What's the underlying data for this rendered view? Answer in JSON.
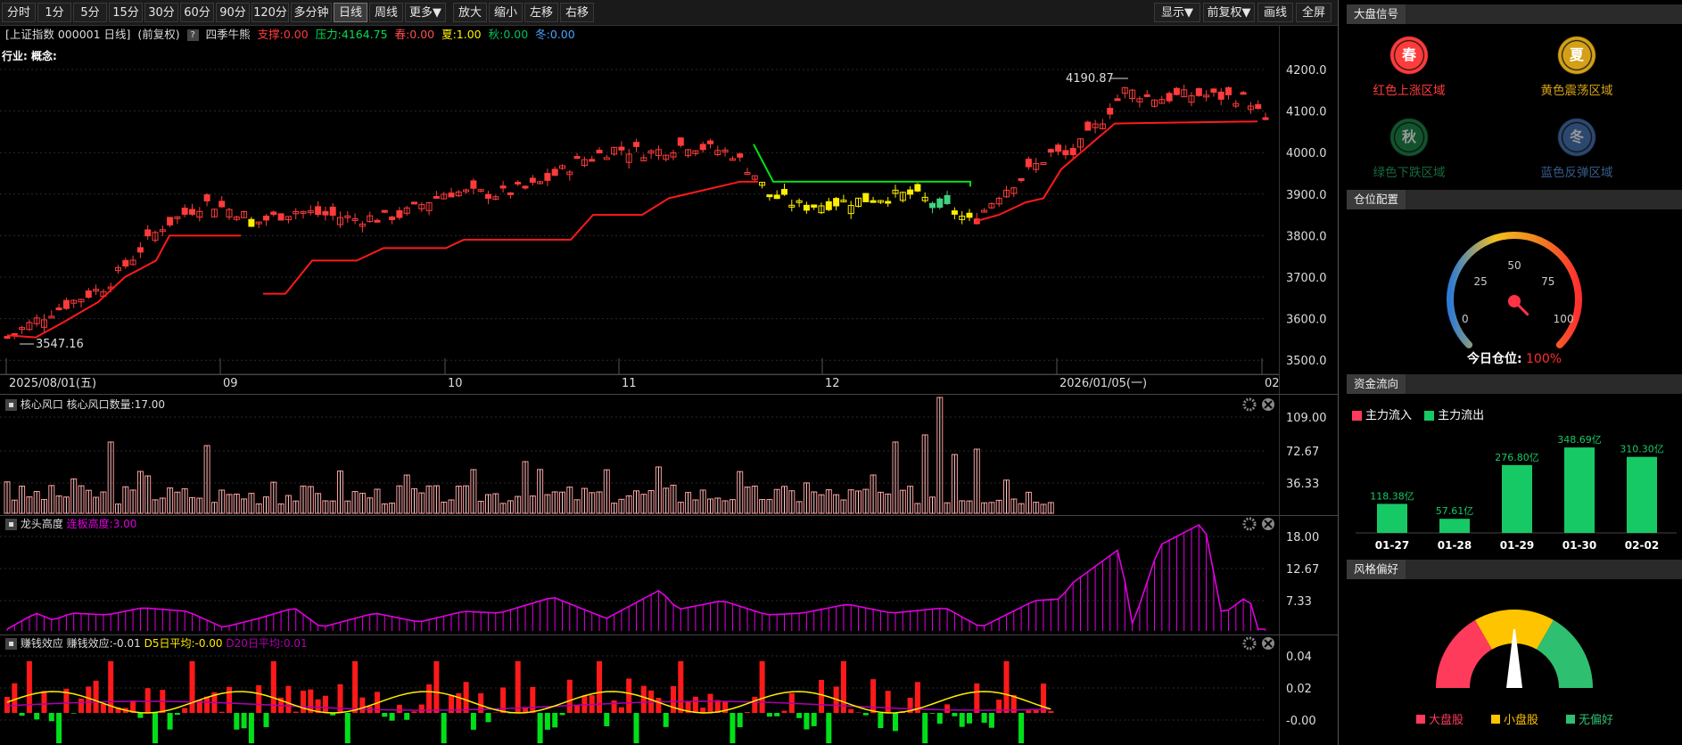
{
  "toolbar": {
    "left": [
      {
        "label": "分时",
        "active": false
      },
      {
        "label": "1分",
        "active": false
      },
      {
        "label": "5分",
        "active": false
      },
      {
        "label": "15分",
        "active": false
      },
      {
        "label": "30分",
        "active": false
      },
      {
        "label": "60分",
        "active": false
      },
      {
        "label": "90分",
        "active": false
      },
      {
        "label": "120分",
        "active": false
      },
      {
        "label": "多分钟",
        "active": false
      },
      {
        "label": "日线",
        "active": true
      },
      {
        "label": "周线",
        "active": false
      },
      {
        "label": "更多▼",
        "active": false
      },
      {
        "label": "放大",
        "active": false
      },
      {
        "label": "缩小",
        "active": false
      },
      {
        "label": "左移",
        "active": false
      },
      {
        "label": "右移",
        "active": false
      }
    ],
    "right": [
      {
        "label": "显示▼"
      },
      {
        "label": "前复权▼"
      },
      {
        "label": "画线"
      },
      {
        "label": "全屏"
      }
    ]
  },
  "info": {
    "index": "[上证指数 000001 日线]",
    "adjust": "(前复权)",
    "q": "?",
    "indicator": "四季牛熊",
    "support": "支撑:0.00",
    "pressure": "压力:4164.75",
    "spring": "春:0.00",
    "summer": "夏:1.00",
    "autumn": "秋:0.00",
    "winter": "冬:0.00",
    "industry": "行业: 概念:"
  },
  "main_chart": {
    "y_ticks": [
      "4200.0",
      "4100.0",
      "4000.0",
      "3900.0",
      "3800.0",
      "3700.0",
      "3600.0",
      "3500.0"
    ],
    "high_label": "4190.87",
    "low_label": "3547.16",
    "x_labels": [
      "2025/08/01(五)",
      "09",
      "10",
      "11",
      "12",
      "2026/01/05(一)",
      "02"
    ]
  },
  "panel1": {
    "name": "核心风口",
    "value_text": "核心风口数量:17.00",
    "y_ticks": [
      "109.00",
      "72.67",
      "36.33"
    ]
  },
  "panel2": {
    "name": "龙头高度",
    "value_text": "连板高度:3.00",
    "y_ticks": [
      "18.00",
      "12.67",
      "7.33"
    ]
  },
  "panel3": {
    "name": "赚钱效应",
    "value_text": "赚钱效应:-0.01",
    "d5": "D5日平均:-0.00",
    "d20": "D20日平均:0.01",
    "y_ticks": [
      "0.04",
      "0.02",
      "-0.00"
    ]
  },
  "signal": {
    "title": "大盘信号",
    "items": [
      {
        "glyph": "春",
        "label": "红色上涨区域",
        "color": "#ff3b3b"
      },
      {
        "glyph": "夏",
        "label": "黄色震荡区域",
        "color": "#d4a017"
      },
      {
        "glyph": "秋",
        "label": "绿色下跌区域",
        "color": "#1f8a4c"
      },
      {
        "glyph": "冬",
        "label": "蓝色反弹区域",
        "color": "#4a78b8"
      }
    ]
  },
  "position": {
    "title": "仓位配置",
    "ticks": [
      "0",
      "25",
      "50",
      "75",
      "100"
    ],
    "label": "今日仓位:",
    "value": "100%",
    "level": 1.0
  },
  "fundflow": {
    "title": "资金流向",
    "legend_in": "主力流入",
    "legend_out": "主力流出",
    "bars": [
      {
        "date": "01-27",
        "value": 118.38,
        "label": "118.38亿"
      },
      {
        "date": "01-28",
        "value": 57.61,
        "label": "57.61亿"
      },
      {
        "date": "01-29",
        "value": 276.8,
        "label": "276.80亿"
      },
      {
        "date": "01-30",
        "value": 348.69,
        "label": "348.69亿"
      },
      {
        "date": "02-02",
        "value": 310.3,
        "label": "310.30亿"
      }
    ]
  },
  "style": {
    "title": "风格偏好",
    "legend": [
      {
        "label": "大盘股",
        "color": "#ff3b5c"
      },
      {
        "label": "小盘股",
        "color": "#ffc400"
      },
      {
        "label": "无偏好",
        "color": "#2fbf71"
      }
    ],
    "pointer": "小盘股"
  },
  "colors": {
    "up": "#ff3b3b",
    "down_green": "#00d26a",
    "yellow": "#ffee00",
    "magenta": "#e000e0",
    "pink": "#ff9a9a"
  }
}
